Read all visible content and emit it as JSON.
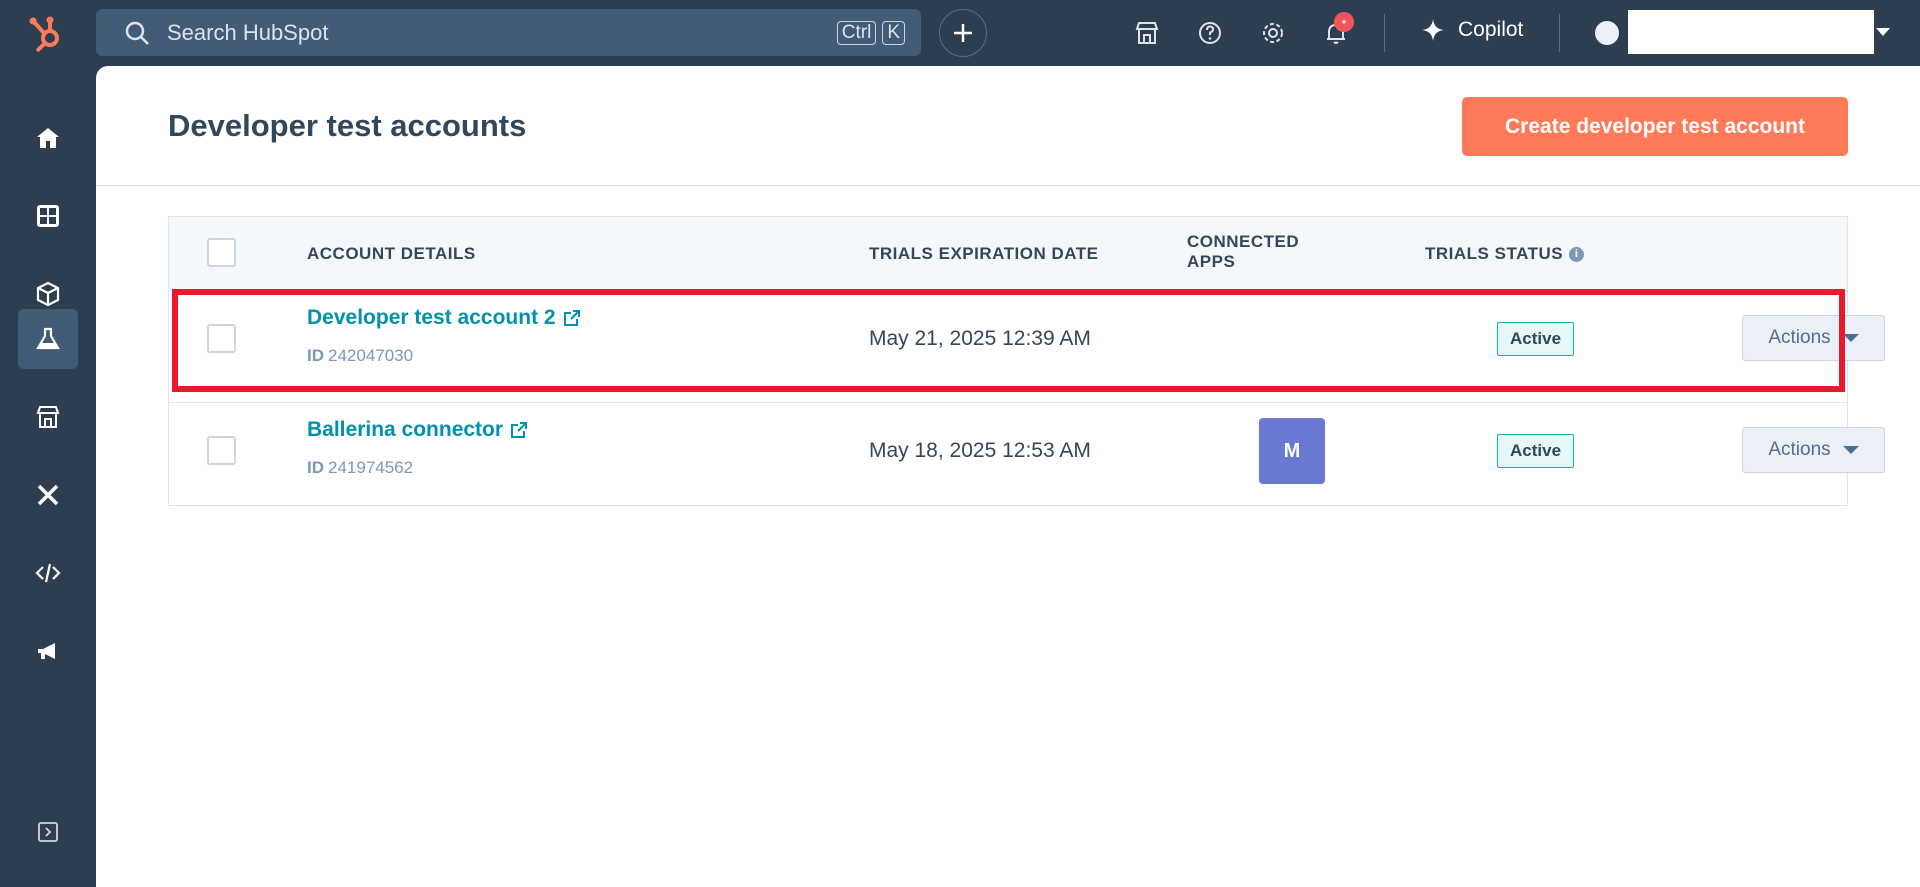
{
  "topbar": {
    "search_placeholder": "Search HubSpot",
    "shortcut_keys": [
      "Ctrl",
      "K"
    ],
    "notification_count": "•",
    "copilot_label": "Copilot"
  },
  "sidebar": {
    "items": [
      {
        "icon": "home-icon"
      },
      {
        "icon": "apps-dashboard-icon"
      },
      {
        "icon": "cube-icon"
      },
      {
        "icon": "flask-icon",
        "active": true
      },
      {
        "icon": "storefront-icon"
      },
      {
        "icon": "tools-icon"
      },
      {
        "icon": "code-icon"
      },
      {
        "icon": "megaphone-icon"
      }
    ],
    "expand_icon": "expand-sidebar-icon"
  },
  "page": {
    "title": "Developer test accounts",
    "create_button": "Create developer test account"
  },
  "table": {
    "headers": {
      "account_details": "ACCOUNT DETAILS",
      "expiration": "TRIALS EXPIRATION DATE",
      "connected_apps_1": "CONNECTED",
      "connected_apps_2": "APPS",
      "status": "TRIALS STATUS"
    },
    "rows": [
      {
        "name": "Developer test account 2",
        "id_label": "ID",
        "id": "242047030",
        "expiration": "May 21, 2025 12:39 AM",
        "connected_app": "",
        "status": "Active",
        "actions": "Actions"
      },
      {
        "name": "Ballerina connector",
        "id_label": "ID",
        "id": "241974562",
        "expiration": "May 18, 2025 12:53 AM",
        "connected_app": "M",
        "status": "Active",
        "actions": "Actions"
      }
    ]
  },
  "colors": {
    "nav_bg": "#2d3e50",
    "accent_orange": "#ff7a59",
    "link_teal": "#0091ae",
    "highlight_red": "#e8192c",
    "app_badge": "#6a78d1"
  }
}
